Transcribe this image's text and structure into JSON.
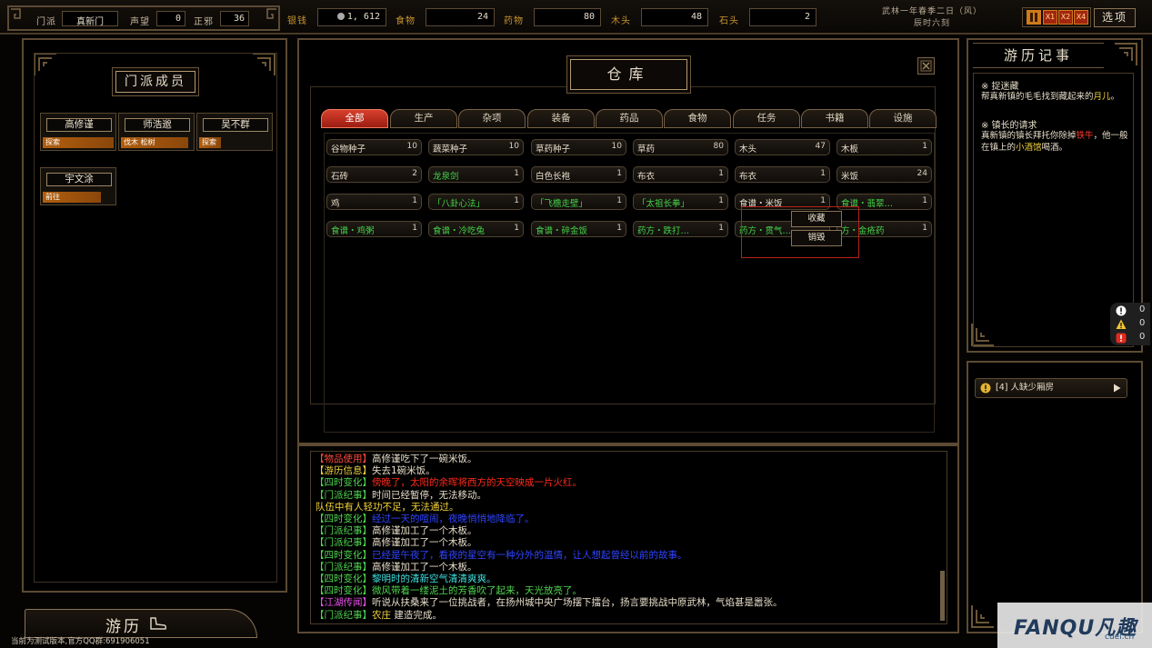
{
  "topbar": {
    "sect_label": "门派",
    "sect_value": "真新门",
    "prestige_label": "声望",
    "prestige_value": "0",
    "alignment_label": "正邪",
    "alignment_value": "36",
    "silver_label": "银钱",
    "silver_value": "1, 612",
    "food_label": "食物",
    "food_value": "24",
    "medicine_label": "药物",
    "medicine_value": "80",
    "wood_label": "木头",
    "wood_value": "48",
    "stone_label": "石头",
    "stone_value": "2",
    "date_line1": "武林一年春季二日（风）",
    "date_line2": "辰时六刻",
    "speed_buttons": [
      "X1",
      "X2",
      "X4"
    ],
    "options_label": "选项"
  },
  "left": {
    "title": "门派成员",
    "members": [
      {
        "name": "高修谨",
        "task": "探索"
      },
      {
        "name": "师浩邈",
        "task": "伐木 松树"
      },
      {
        "name": "吴不群",
        "task": "探索"
      },
      {
        "name": "宇文涂",
        "task": "前往"
      }
    ],
    "travel_label": "游历"
  },
  "warehouse": {
    "title": "仓库",
    "tabs": [
      "全部",
      "生产",
      "杂项",
      "装备",
      "药品",
      "食物",
      "任务",
      "书籍",
      "设施"
    ],
    "active_tab": "全部",
    "items": [
      {
        "name": "谷物种子",
        "count": "10",
        "color": "white"
      },
      {
        "name": "蔬菜种子",
        "count": "10",
        "color": "white"
      },
      {
        "name": "草药种子",
        "count": "10",
        "color": "white"
      },
      {
        "name": "草药",
        "count": "80",
        "color": "white"
      },
      {
        "name": "木头",
        "count": "47",
        "color": "white"
      },
      {
        "name": "木板",
        "count": "1",
        "color": "white"
      },
      {
        "name": "石砖",
        "count": "2",
        "color": "white"
      },
      {
        "name": "龙泉剑",
        "count": "1",
        "color": "green"
      },
      {
        "name": "白色长袍",
        "count": "1",
        "color": "white"
      },
      {
        "name": "布衣",
        "count": "1",
        "color": "white"
      },
      {
        "name": "布衣",
        "count": "1",
        "color": "white"
      },
      {
        "name": "米饭",
        "count": "24",
        "color": "white"
      },
      {
        "name": "鸡",
        "count": "1",
        "color": "white"
      },
      {
        "name": "「八卦心法」",
        "count": "1",
        "color": "green"
      },
      {
        "name": "「飞檐走壁」",
        "count": "1",
        "color": "green"
      },
      {
        "name": "「太祖长拳」",
        "count": "1",
        "color": "green"
      },
      {
        "name": "食谱・米饭",
        "count": "1",
        "color": "white"
      },
      {
        "name": "食谱・翡翠…",
        "count": "1",
        "color": "green"
      },
      {
        "name": "食谱・鸡粥",
        "count": "1",
        "color": "green"
      },
      {
        "name": "食谱・冷吃兔",
        "count": "1",
        "color": "green"
      },
      {
        "name": "食谱・碎金饭",
        "count": "1",
        "color": "green"
      },
      {
        "name": "药方・跌打…",
        "count": "1",
        "color": "green"
      },
      {
        "name": "药方・贯气…",
        "count": "",
        "color": "green"
      },
      {
        "name": "方・金疮药",
        "count": "1",
        "color": "green"
      }
    ],
    "context_menu": {
      "favorite": "收藏",
      "destroy": "销毁"
    }
  },
  "log": [
    {
      "tag": "【物品使用】",
      "tag_color": "#ff4a3a",
      "text": "高修谨吃下了一碗米饭。",
      "text_color": "#e7ddca"
    },
    {
      "tag": "【游历信息】",
      "tag_color": "#f2d23a",
      "text": "失去1碗米饭。",
      "text_color": "#e7ddca"
    },
    {
      "tag": "【四时变化】",
      "tag_color": "#4fd64f",
      "text": "傍晚了，太阳的余晖将西方的天空映成一片火红。",
      "text_color": "#ff2a1a"
    },
    {
      "tag": "【门派纪事】",
      "tag_color": "#4fd64f",
      "text": "时间已经暂停，无法移动。",
      "text_color": "#e7ddca"
    },
    {
      "tag": "",
      "tag_color": "#f2d23a",
      "text": "队伍中有人轻功不足，无法通过。",
      "text_color": "#f2d23a"
    },
    {
      "tag": "【四时变化】",
      "tag_color": "#4fd64f",
      "text": "经过一天的喧闹，夜晚悄悄地降临了。",
      "text_color": "#2f45ff"
    },
    {
      "tag": "【门派纪事】",
      "tag_color": "#4fd64f",
      "text": "高修谨加工了一个木板。",
      "text_color": "#e7ddca"
    },
    {
      "tag": "【门派纪事】",
      "tag_color": "#4fd64f",
      "text": "高修谨加工了一个木板。",
      "text_color": "#e7ddca"
    },
    {
      "tag": "【四时变化】",
      "tag_color": "#4fd64f",
      "text": "已经是午夜了，看夜的星空有一种分外的温情，让人想起曾经以前的故事。",
      "text_color": "#2f45ff"
    },
    {
      "tag": "【门派纪事】",
      "tag_color": "#4fd64f",
      "text": "高修谨加工了一个木板。",
      "text_color": "#e7ddca"
    },
    {
      "tag": "【四时变化】",
      "tag_color": "#4fd64f",
      "text": "黎明时的清新空气清清爽爽。",
      "text_color": "#3ee0e0"
    },
    {
      "tag": "【四时变化】",
      "tag_color": "#4fd64f",
      "text": "微风带着一缕泥土的芳香吹了起来，天光放亮了。",
      "text_color": "#4fd64f"
    },
    {
      "tag": "【江湖传闻】",
      "tag_color": "#e64fe6",
      "text": "听说从扶桑来了一位挑战者，在扬州城中央广场摆下擂台，扬言要挑战中原武林，气焰甚是嚣张。",
      "text_color": "#e7ddca"
    },
    {
      "tag": "【门派纪事】",
      "tag_color": "#4fd64f",
      "text": "农庄",
      "text_color": "#f2d23a",
      "text2": " 建造完成。"
    }
  ],
  "journal": {
    "title": "游历记事",
    "entries": [
      {
        "heading": "※ 捉迷藏",
        "body_pre": "帮真新镇的毛毛找到藏起来的",
        "body_hl": "月儿",
        "body_post": "。",
        "hl": "yellow"
      },
      {
        "heading": "※ 镇长的请求",
        "body_pre": "真新镇的镇长拜托你除掉",
        "body_hl": "铁牛",
        "body_mid": "，他一般在镇上的",
        "body_hl2": "小酒馆",
        "body_post": "喝酒。",
        "hl": "red"
      }
    ]
  },
  "alerts": {
    "item": "[4] 人缺少厢房",
    "counters": {
      "info": "0",
      "warning": "0",
      "error": "0"
    }
  },
  "footer": {
    "version": "当前为测试版本,官方QQ群:691906051",
    "watermark_main": "FANQU凡趣",
    "watermark_sub": "cuei.cn"
  },
  "colors": {
    "frame": "#5c4a33",
    "accent_gold": "#c9932e",
    "tab_active": "#c6301f",
    "item_green": "#45d44a"
  }
}
